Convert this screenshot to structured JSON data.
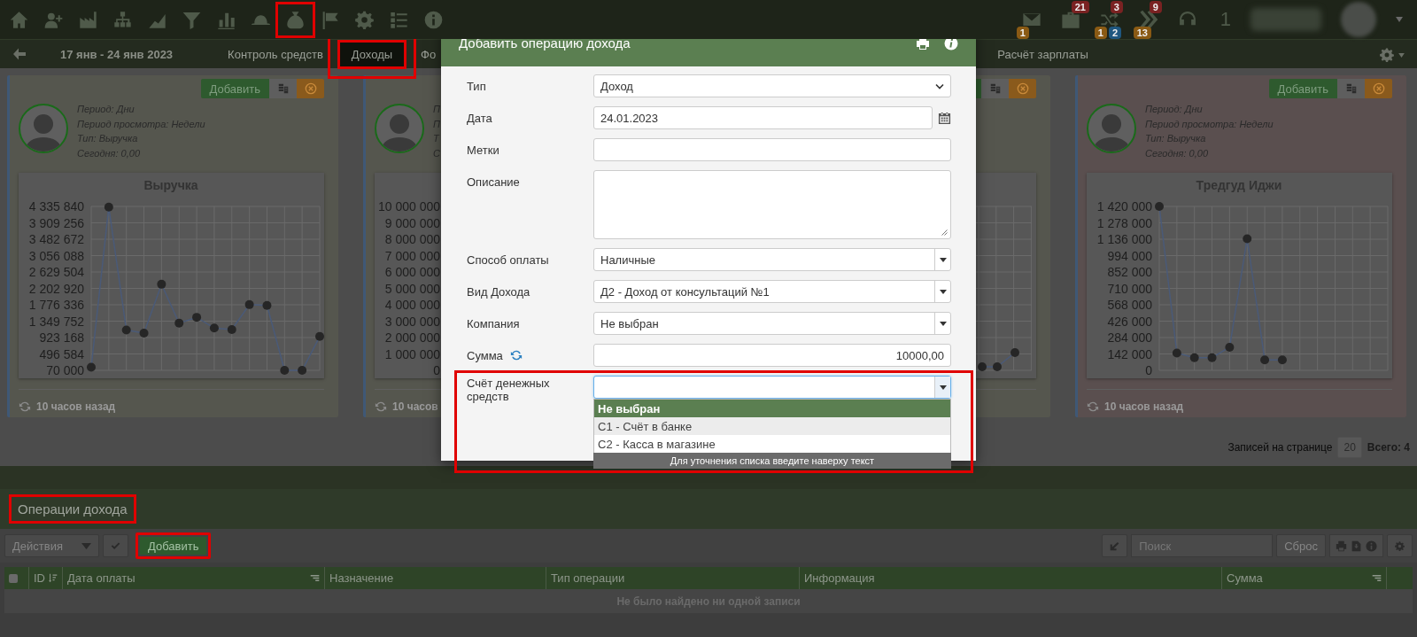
{
  "top_nav": {
    "icons": [
      {
        "kind": "home",
        "highlighted": false
      },
      {
        "kind": "user-plus",
        "highlighted": false
      },
      {
        "kind": "factory",
        "highlighted": false
      },
      {
        "kind": "sitemap",
        "highlighted": false
      },
      {
        "kind": "area-chart",
        "highlighted": false
      },
      {
        "kind": "filter",
        "highlighted": false
      },
      {
        "kind": "bar-chart",
        "highlighted": false
      },
      {
        "kind": "hat",
        "highlighted": false
      },
      {
        "kind": "money-bag",
        "highlighted": true
      },
      {
        "kind": "flag",
        "highlighted": false
      },
      {
        "kind": "gear",
        "highlighted": false
      },
      {
        "kind": "list",
        "highlighted": false
      },
      {
        "kind": "info",
        "highlighted": false
      }
    ],
    "alerts": [
      {
        "kind": "envelope",
        "sub_badges": [
          {
            "text": "1",
            "color": "#8a5a14"
          }
        ]
      },
      {
        "kind": "briefcase",
        "badge": {
          "text": "21",
          "color": "#7a2222"
        }
      },
      {
        "kind": "shuffle",
        "badge": {
          "text": "3",
          "color": "#7a2222"
        },
        "sub_badges": [
          {
            "text": "1",
            "color": "#8a5a14"
          },
          {
            "text": "2",
            "color": "#1f5780"
          }
        ]
      },
      {
        "kind": "chevrons",
        "badge": {
          "text": "9",
          "color": "#7a2222"
        },
        "sub_badges": [
          {
            "text": "13",
            "color": "#8a5a14"
          }
        ]
      },
      {
        "kind": "headset"
      }
    ],
    "counter": "1"
  },
  "sub_nav": {
    "date_range": "17 янв - 24 янв 2023",
    "tabs": [
      {
        "label": "Контроль средств",
        "selected": false,
        "highlighted": false
      },
      {
        "label": "Доходы",
        "selected": true,
        "highlighted": true
      },
      {
        "label": "Фо",
        "selected": false,
        "highlighted": false
      },
      {
        "label": "Расчёт зарплаты",
        "selected": false,
        "highlighted": false
      }
    ]
  },
  "cards": [
    {
      "color": "#55564e",
      "add_button": "Добавить",
      "info": [
        "Период: Дни",
        "Период просмотра: Недели",
        "Тип: Выручка",
        "Сегодня: 0,00"
      ],
      "chart": {
        "kind": "chart",
        "chart_data": {
          "type": "line",
          "title": "Выручка",
          "grid": true,
          "ylim": [
            70000,
            4335840
          ],
          "yticks": [
            {
              "value": 70000,
              "label": "70 000"
            },
            {
              "value": 496584,
              "label": "496 584"
            },
            {
              "value": 923168,
              "label": "923 168"
            },
            {
              "value": 1349752,
              "label": "1 349 752"
            },
            {
              "value": 1776336,
              "label": "1 776 336"
            },
            {
              "value": 2202920,
              "label": "2 202 920"
            },
            {
              "value": 2629504,
              "label": "2 629 504"
            },
            {
              "value": 3056088,
              "label": "3 056 088"
            },
            {
              "value": 3482672,
              "label": "3 482 672"
            },
            {
              "value": 3909256,
              "label": "3 909 256"
            },
            {
              "value": 4335840,
              "label": "4 335 840"
            }
          ],
          "categories": [
            null,
            null,
            null,
            null,
            null,
            null,
            null,
            null,
            null,
            null,
            null,
            null,
            null,
            null
          ],
          "series": [
            {
              "marker": true,
              "values": [
                150000,
                4320000,
                1120000,
                1040000,
                2310000,
                1300000,
                1450000,
                1170000,
                1130000,
                1780000,
                1760000,
                70000,
                70000,
                950000
              ]
            }
          ]
        }
      },
      "updated": "10 часов назад"
    },
    {
      "color": "#55564e",
      "info": [
        "П",
        "П",
        "Т",
        "С"
      ],
      "chart": {
        "kind": "axes",
        "tick_labels": [
          "10 000 000",
          "9 000 000",
          "8 000 000",
          "7 000 000",
          "6 000 000",
          "5 000 000",
          "4 000 000",
          "3 000 000",
          "2 000 000",
          "1 000 000",
          "0"
        ]
      },
      "updated": "10 часов"
    },
    {
      "color": "#55564e",
      "chart": {
        "kind": "picture"
      }
    },
    {
      "color": "#5a4f4f",
      "add_button": "Добавить",
      "info": [
        "Период: Дни",
        "Период просмотра: Недели",
        "Тип: Выручка",
        "Сегодня: 0,00"
      ],
      "chart": {
        "kind": "chart",
        "chart_data": {
          "type": "line",
          "title": "Тредгуд Иджи",
          "grid": true,
          "ylim": [
            0,
            1420000
          ],
          "yticks": [
            {
              "value": 0,
              "label": "0"
            },
            {
              "value": 142000,
              "label": "142 000"
            },
            {
              "value": 284000,
              "label": "284 000"
            },
            {
              "value": 426000,
              "label": "426 000"
            },
            {
              "value": 568000,
              "label": "568 000"
            },
            {
              "value": 710000,
              "label": "710 000"
            },
            {
              "value": 852000,
              "label": "852 000"
            },
            {
              "value": 994000,
              "label": "994 000"
            },
            {
              "value": 1136000,
              "label": "1 136 000"
            },
            {
              "value": 1278000,
              "label": "1 278 000"
            },
            {
              "value": 1420000,
              "label": "1 420 000"
            }
          ],
          "categories": [
            null,
            null,
            null,
            null,
            null,
            null,
            null,
            null,
            null,
            null,
            null,
            null,
            null,
            null
          ],
          "series": [
            {
              "marker": true,
              "values": [
                1420000,
                150000,
                110000,
                110000,
                200000,
                1140000,
                90000,
                90000,
                null,
                null,
                null,
                null,
                null,
                null
              ]
            }
          ]
        }
      },
      "updated": "10 часов назад"
    }
  ],
  "pagination": {
    "label": "Записей на странице",
    "page_size": "20",
    "total": "Всего: 4"
  },
  "modal": {
    "title": "Добавить операцию дохода",
    "fields": [
      {
        "kind": "select",
        "label": "Тип",
        "value": "Доход"
      },
      {
        "kind": "date",
        "label": "Дата",
        "value": "24.01.2023"
      },
      {
        "kind": "text",
        "label": "Метки"
      },
      {
        "kind": "textarea",
        "label": "Описание"
      },
      {
        "kind": "combo",
        "label": "Способ оплаты",
        "value": "Наличные",
        "expanded": false
      },
      {
        "kind": "combo",
        "label": "Вид Дохода",
        "value": "Д2 - Доход от консультаций №1",
        "expanded": false
      },
      {
        "kind": "combo",
        "label": "Компания",
        "value": "Не выбран",
        "expanded": false
      },
      {
        "kind": "amount",
        "label": "Сумма",
        "value": "10000,00"
      },
      {
        "kind": "combo",
        "label": "Счёт денежных средств",
        "expanded": true,
        "highlighted": true,
        "options": [
          {
            "text": "Не выбран",
            "selected": true,
            "hovered": false
          },
          {
            "text": "C1 - Счёт в банке",
            "selected": false,
            "hovered": true
          },
          {
            "text": "C2 - Касса в магазине",
            "selected": false,
            "hovered": false
          }
        ],
        "hint": "Для уточнения списка введите наверху текст"
      }
    ]
  },
  "operations": {
    "title": "Операции дохода",
    "highlighted": true,
    "toolbar": {
      "actions": "Действия",
      "add": "Добавить",
      "add_highlighted": true,
      "search_placeholder": "Поиск",
      "reset": "Сброс"
    },
    "table": {
      "select_all_checked": false,
      "columns": [
        {
          "label": "ID",
          "kind": "sort"
        },
        {
          "label": "Дата оплаты",
          "kind": "menu"
        },
        {
          "label": "Назначение",
          "kind": "plain"
        },
        {
          "label": "Тип операции",
          "kind": "plain"
        },
        {
          "label": "Информация",
          "kind": "plain"
        },
        {
          "label": "Сумма",
          "kind": "menu"
        }
      ],
      "empty_message": "Не было найдено ни одной записи"
    }
  }
}
